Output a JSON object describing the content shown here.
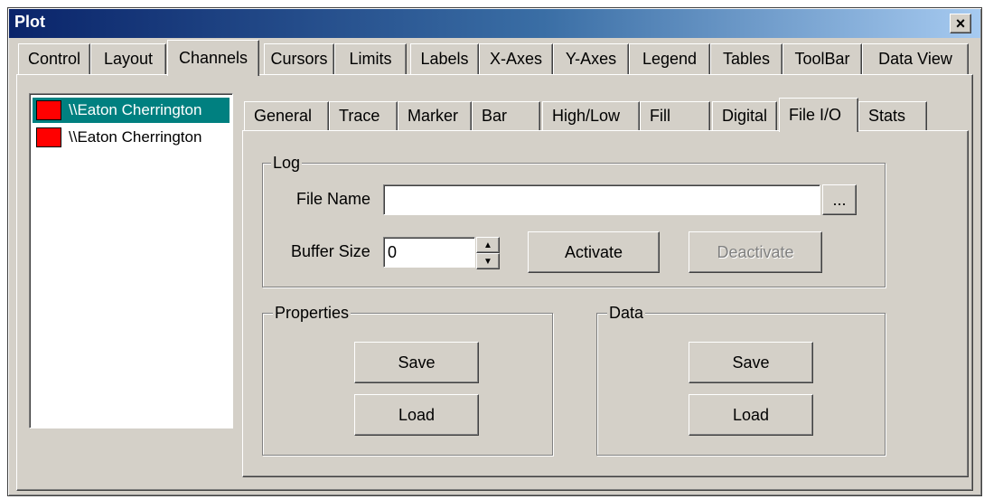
{
  "window": {
    "title": "Plot"
  },
  "main_tabs": [
    {
      "label": "Control"
    },
    {
      "label": "Layout"
    },
    {
      "label": "Channels"
    },
    {
      "label": "Cursors"
    },
    {
      "label": "Limits"
    },
    {
      "label": "Labels"
    },
    {
      "label": "X-Axes"
    },
    {
      "label": "Y-Axes"
    },
    {
      "label": "Legend"
    },
    {
      "label": "Tables"
    },
    {
      "label": "ToolBar"
    },
    {
      "label": "Data View"
    }
  ],
  "channel_list": [
    {
      "label": "\\\\Eaton Cherrington",
      "color": "#ff0000"
    },
    {
      "label": "\\\\Eaton Cherrington",
      "color": "#ff0000"
    }
  ],
  "sub_tabs": [
    {
      "label": "General"
    },
    {
      "label": "Trace"
    },
    {
      "label": "Marker"
    },
    {
      "label": "Bar"
    },
    {
      "label": "High/Low"
    },
    {
      "label": "Fill"
    },
    {
      "label": "Digital"
    },
    {
      "label": "File I/O"
    },
    {
      "label": "Stats"
    }
  ],
  "log": {
    "group_label": "Log",
    "file_name_label": "File Name",
    "file_name_value": "",
    "browse_label": "...",
    "buffer_size_label": "Buffer Size",
    "buffer_size_value": "0",
    "activate_label": "Activate",
    "deactivate_label": "Deactivate"
  },
  "properties": {
    "group_label": "Properties",
    "save_label": "Save",
    "load_label": "Load"
  },
  "data": {
    "group_label": "Data",
    "save_label": "Save",
    "load_label": "Load"
  },
  "icons": {
    "close": "×",
    "spin_up": "▲",
    "spin_down": "▼"
  }
}
